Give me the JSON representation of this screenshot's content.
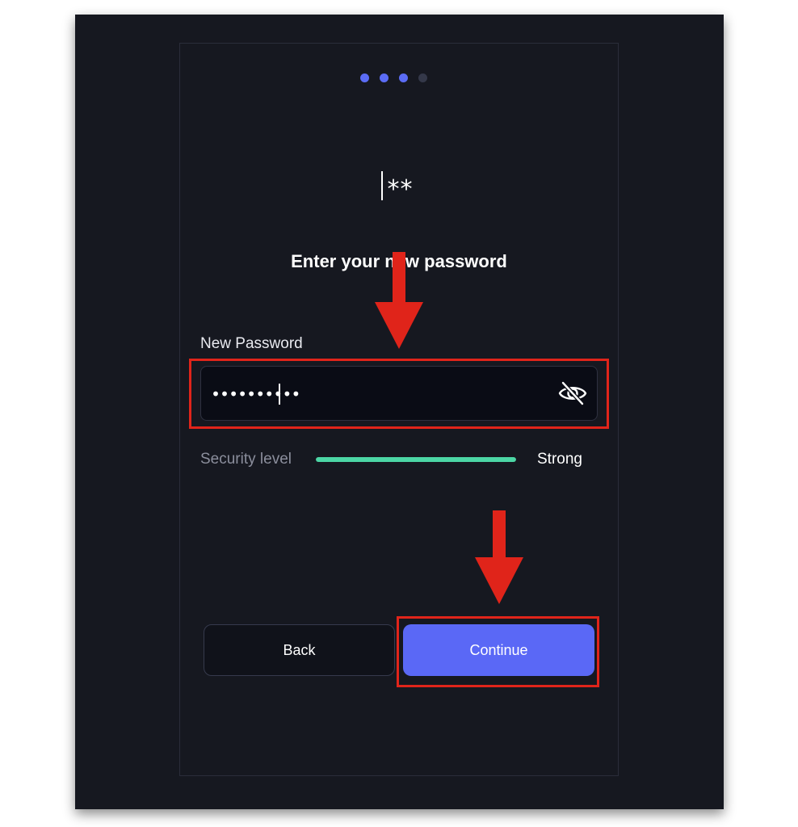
{
  "steps": {
    "total": 4,
    "current": 3
  },
  "header": {
    "icon": "password-asterisk-icon",
    "icon_text": "**",
    "title": "Enter your new password"
  },
  "password_field": {
    "label": "New Password",
    "value": "••••••••••",
    "visibility_icon": "eye-off-icon"
  },
  "security": {
    "label": "Security level",
    "level_text": "Strong",
    "level_fraction": 1.0,
    "bar_color": "#4cd6a5"
  },
  "actions": {
    "back_label": "Back",
    "continue_label": "Continue"
  },
  "colors": {
    "accent": "#5a68f6",
    "background": "#161820",
    "annotation": "#e0241a"
  }
}
